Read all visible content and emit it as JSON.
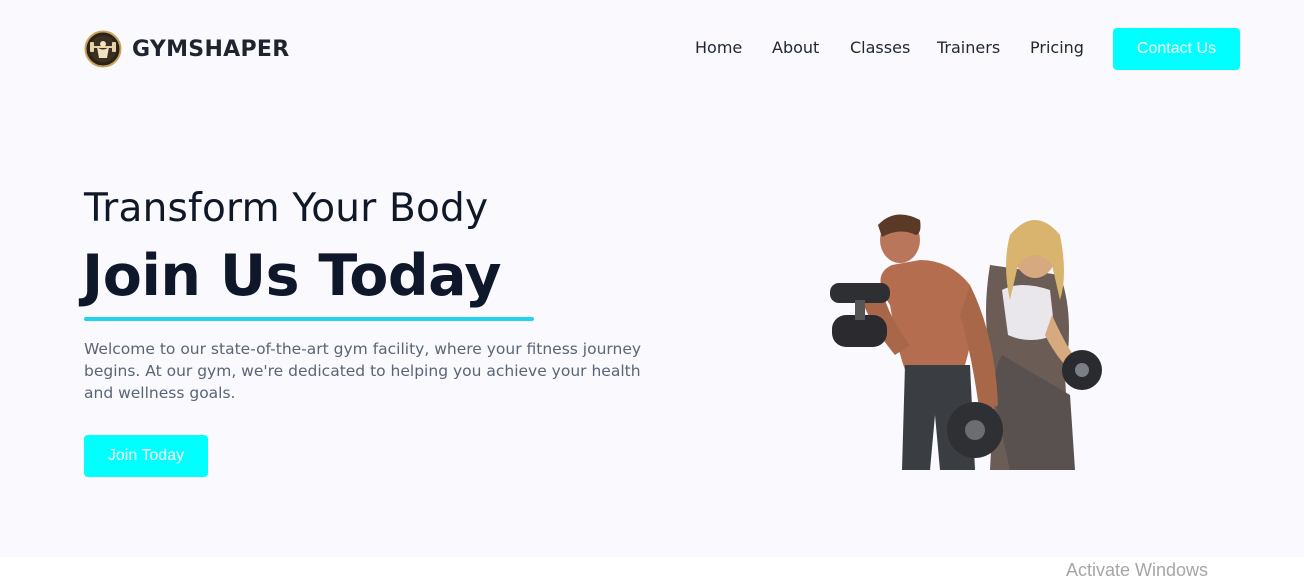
{
  "brand": {
    "name": "GYMSHAPER",
    "logo_icon": "dumbbell-bodybuilder-logo-icon"
  },
  "nav": {
    "links": [
      "Home",
      "About",
      "Classes",
      "Trainers",
      "Pricing"
    ],
    "contact_label": "Contact Us"
  },
  "hero": {
    "kicker": "Transform Your Body",
    "title": "Join Us Today",
    "description": "Welcome to our state-of-the-art gym facility, where your fitness journey begins. At our gym, we're dedicated to helping you achieve your health and wellness goals.",
    "cta_label": "Join Today",
    "image_icon": "athletes-with-dumbbells-illustration"
  },
  "colors": {
    "accent": "#00ffff",
    "underline": "#22d3ee",
    "background": "#f9f9fe",
    "heading": "#0f172a",
    "body_text": "#5a6575"
  },
  "system": {
    "watermark": "Activate Windows"
  }
}
